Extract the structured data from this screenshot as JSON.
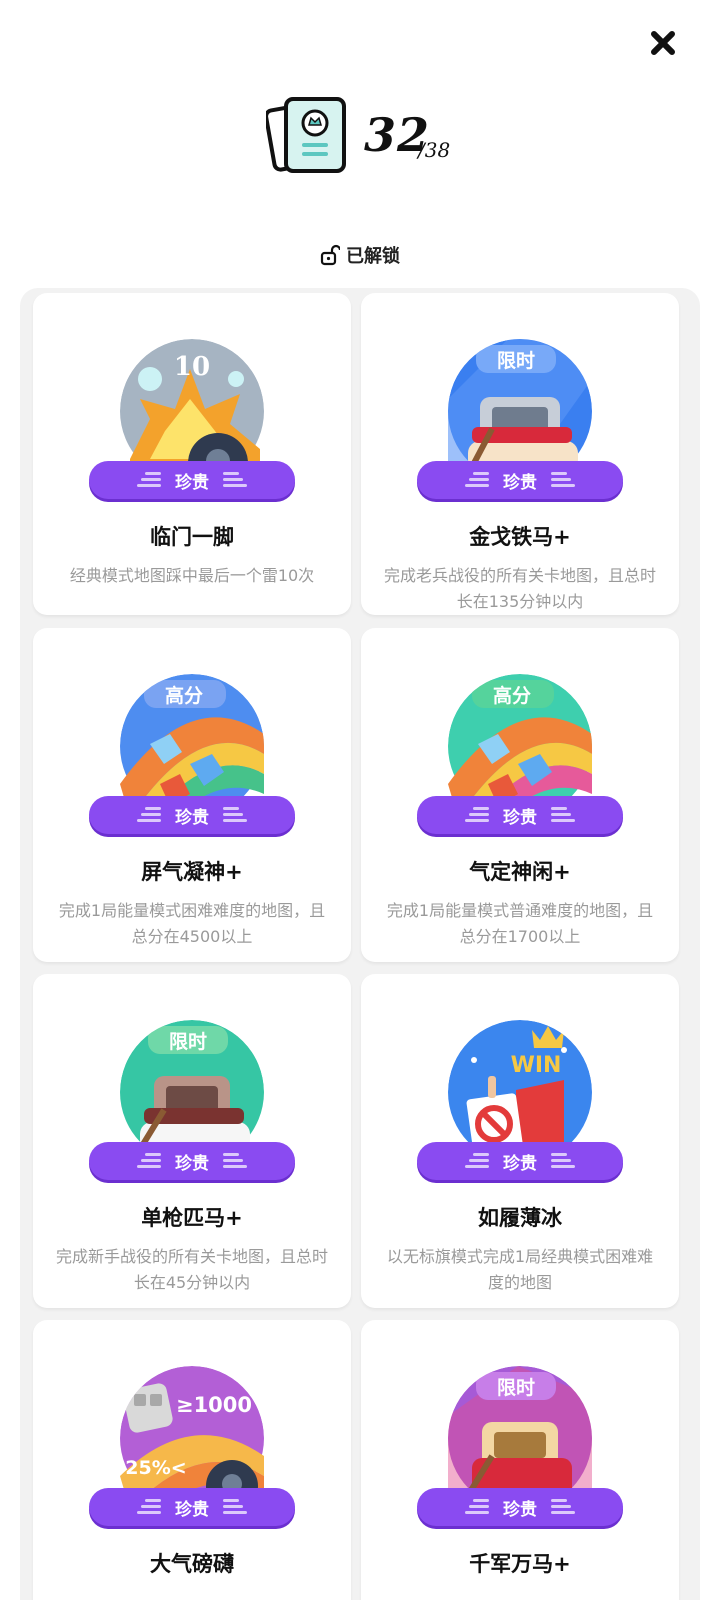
{
  "header": {
    "count_current": "32",
    "count_total": "/38"
  },
  "filter": {
    "label": "已解锁",
    "icon": "unlock-icon"
  },
  "close_icon": "close-icon",
  "colors": {
    "rarity_bg": "#8a4bf1",
    "panel_bg": "#f2f2f2",
    "desc_text": "#9a9a9a"
  },
  "achievements": [
    {
      "title": "临门一脚",
      "desc": "经典模式地图踩中最后一个雷10次",
      "rarity": "珍贵",
      "badge_icon": "mine-explosion-icon",
      "badge_tag": "10"
    },
    {
      "title": "金戈铁马+",
      "desc": "完成老兵战役的所有关卡地图，且总时长在135分钟以内",
      "rarity": "珍贵",
      "badge_icon": "knight-helmet-icon",
      "badge_tag": "限时"
    },
    {
      "title": "屏气凝神+",
      "desc": "完成1局能量模式困难难度的地图，且总分在4500以上",
      "rarity": "珍贵",
      "badge_icon": "rainbow-blocks-icon",
      "badge_tag": "高分"
    },
    {
      "title": "气定神闲+",
      "desc": "完成1局能量模式普通难度的地图，且总分在1700以上",
      "rarity": "珍贵",
      "badge_icon": "rainbow-blocks-icon",
      "badge_tag": "高分"
    },
    {
      "title": "单枪匹马+",
      "desc": "完成新手战役的所有关卡地图，且总时长在45分钟以内",
      "rarity": "珍贵",
      "badge_icon": "knight-helmet-icon",
      "badge_tag": "限时"
    },
    {
      "title": "如履薄冰",
      "desc": "以无标旗模式完成1局经典模式困难难度的地图",
      "rarity": "珍贵",
      "badge_icon": "no-flag-win-icon",
      "badge_tag": "WIN"
    },
    {
      "title": "大气磅礴",
      "desc": "",
      "rarity": "珍贵",
      "badge_icon": "mine-score-icon",
      "badge_tag": "≥1000",
      "badge_tag2": "25%<"
    },
    {
      "title": "千军万马+",
      "desc": "",
      "rarity": "珍贵",
      "badge_icon": "knight-helmet-icon",
      "badge_tag": "限时"
    }
  ]
}
